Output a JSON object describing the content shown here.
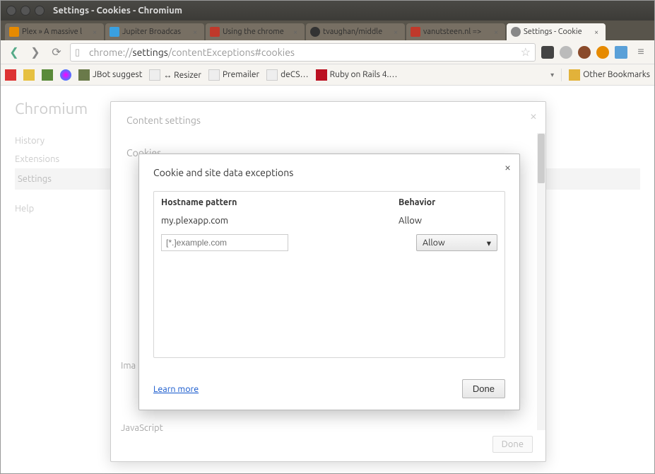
{
  "window": {
    "title": "Settings - Cookies - Chromium"
  },
  "tabs": [
    {
      "label": "Plex » A massive l"
    },
    {
      "label": "Jupiter Broadcas"
    },
    {
      "label": "Using the chrome"
    },
    {
      "label": "tvaughan/middle"
    },
    {
      "label": "vanutsteen.nl =>"
    },
    {
      "label": "Settings - Cookie"
    }
  ],
  "omnibox": {
    "prefix": "chrome://",
    "bold": "settings",
    "suffix": "/contentExceptions#cookies"
  },
  "bookmarks": {
    "items": [
      {
        "label": "JBot suggest"
      },
      {
        "label": "↔ Resizer"
      },
      {
        "label": "Premailer"
      },
      {
        "label": "deCS…"
      },
      {
        "label": "Ruby on Rails 4.…"
      }
    ],
    "other": "Other Bookmarks"
  },
  "page": {
    "brand": "Chromium",
    "nav": {
      "history": "History",
      "extensions": "Extensions",
      "settings": "Settings",
      "help": "Help"
    }
  },
  "content_settings": {
    "title": "Content settings",
    "section_cookies": "Cookies",
    "section_images": "Ima",
    "section_js": "JavaScript",
    "done": "Done"
  },
  "cookie_dialog": {
    "title": "Cookie and site data exceptions",
    "col_host": "Hostname pattern",
    "col_behavior": "Behavior",
    "row": {
      "host": "my.plexapp.com",
      "behavior": "Allow"
    },
    "input_placeholder": "[*.]example.com",
    "select_value": "Allow",
    "learn_more": "Learn more",
    "done": "Done"
  }
}
